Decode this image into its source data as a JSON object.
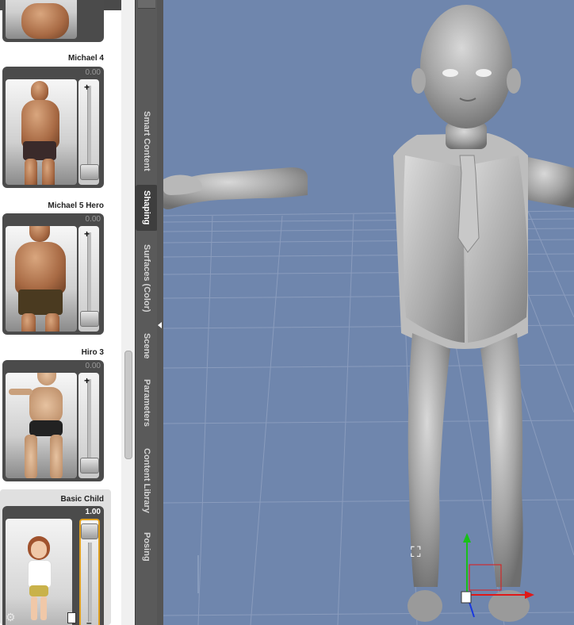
{
  "shaping_panel": {
    "figures": [
      {
        "name": "Michael 4",
        "value": "0.00"
      },
      {
        "name": "Michael 5 Hero",
        "value": "0.00"
      },
      {
        "name": "Hiro 3",
        "value": "0.00"
      },
      {
        "name": "Basic Child",
        "value": "1.00",
        "selected": true
      }
    ],
    "settings_icon": "gear-icon"
  },
  "side_tabs": [
    {
      "label": "Smart Content"
    },
    {
      "label": "Shaping",
      "active": true
    },
    {
      "label": "Surfaces (Color)"
    },
    {
      "label": "Scene"
    },
    {
      "label": "Parameters"
    },
    {
      "label": "Content Library"
    },
    {
      "label": "Posing"
    }
  ],
  "viewport": {
    "background": "#6f86ad",
    "gizmo_colors": {
      "x": "#e01818",
      "y": "#18c018",
      "z": "#1838e0"
    }
  }
}
